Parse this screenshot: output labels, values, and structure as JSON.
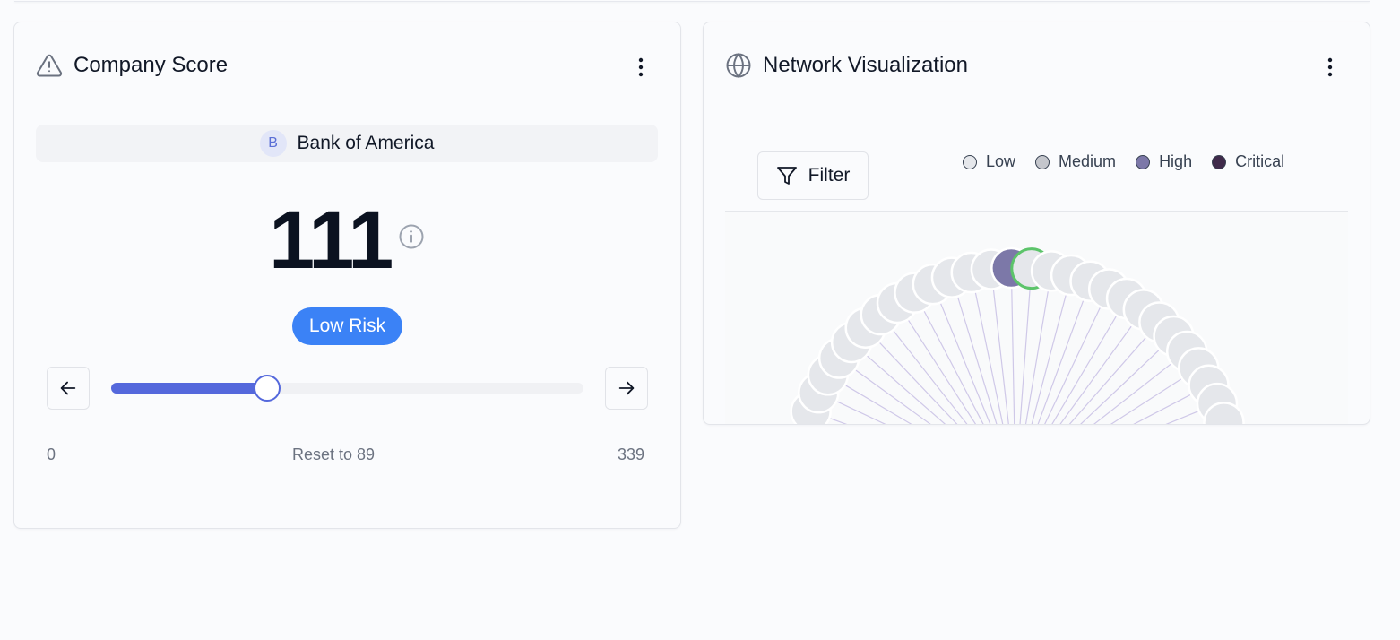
{
  "score_card": {
    "title": "Company Score",
    "menu_icon": "more-vertical-icon",
    "header_icon": "alert-triangle-icon",
    "company": {
      "initial": "B",
      "name": "Bank of America"
    },
    "score": "111",
    "info_icon": "info-icon",
    "risk_label": "Low Risk",
    "risk_color": "#3b82f6",
    "slider": {
      "min_label": "0",
      "max_label": "339",
      "min": 0,
      "max": 339,
      "value": 111,
      "fill_color": "#5468dc"
    },
    "reset_label": "Reset to 89"
  },
  "network_card": {
    "title": "Network Visualization",
    "header_icon": "globe-icon",
    "menu_icon": "more-vertical-icon",
    "filter_label": "Filter",
    "legend": [
      {
        "label": "Low",
        "color": "#e5e7eb"
      },
      {
        "label": "Medium",
        "color": "#c4c6cc"
      },
      {
        "label": "High",
        "color": "#7c78a8"
      },
      {
        "label": "Critical",
        "color": "#3f2a4a"
      }
    ],
    "highlight_color": "#5cc46a"
  }
}
